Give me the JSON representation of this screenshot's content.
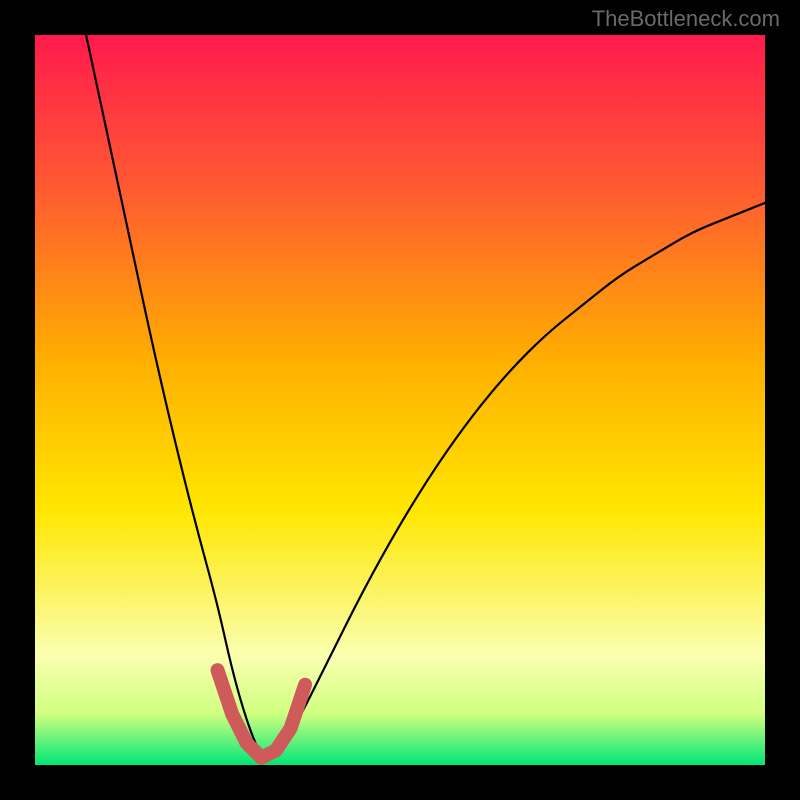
{
  "watermark": "TheBottleneck.com",
  "chart_data": {
    "type": "line",
    "title": "",
    "xlabel": "",
    "ylabel": "",
    "xlim": [
      0,
      100
    ],
    "ylim": [
      0,
      100
    ],
    "background_gradient": {
      "stops": [
        {
          "offset": 0,
          "color": "#ff1a4d"
        },
        {
          "offset": 20,
          "color": "#ff5733"
        },
        {
          "offset": 45,
          "color": "#ffb000"
        },
        {
          "offset": 65,
          "color": "#ffe600"
        },
        {
          "offset": 85,
          "color": "#faffb0"
        },
        {
          "offset": 93,
          "color": "#d0ff80"
        },
        {
          "offset": 100,
          "color": "#00e676"
        }
      ]
    },
    "series": [
      {
        "name": "bottleneck-curve",
        "color": "#000000",
        "x": [
          7,
          10,
          13,
          16,
          19,
          22,
          25,
          27,
          29,
          31,
          33,
          36,
          40,
          45,
          50,
          55,
          60,
          65,
          70,
          75,
          80,
          85,
          90,
          95,
          100
        ],
        "values": [
          100,
          86,
          72,
          58,
          45,
          33,
          22,
          13,
          6,
          1,
          1,
          6,
          14,
          24,
          33,
          41,
          48,
          54,
          59,
          63,
          67,
          70,
          73,
          75,
          77
        ]
      }
    ],
    "highlight_band": {
      "name": "optimal-zone",
      "color": "#d05a5a",
      "x": [
        25,
        27,
        29,
        31,
        33,
        35,
        37
      ],
      "values": [
        13,
        7,
        3,
        1,
        2,
        5,
        11
      ]
    }
  }
}
